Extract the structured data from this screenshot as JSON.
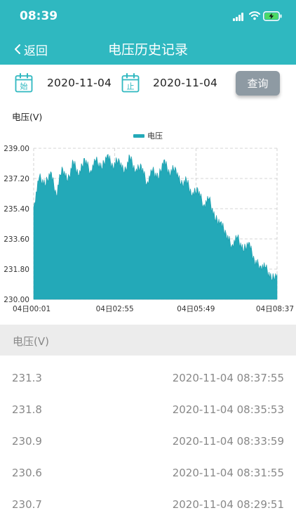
{
  "status_bar": {
    "time": "08:39"
  },
  "nav": {
    "back_label": "返回",
    "title": "电压历史记录"
  },
  "filters": {
    "start_icon_char": "始",
    "start_date": "2020-11-04",
    "end_icon_char": "止",
    "end_date": "2020-11-04",
    "query_label": "查询"
  },
  "chart_data": {
    "type": "area",
    "ylabel": "电压(V)",
    "legend": [
      "电压"
    ],
    "legend_position": "top-center",
    "series_color": "#23a9b8",
    "ylim": [
      230.0,
      239.0
    ],
    "y_ticks": [
      "230.00",
      "231.80",
      "233.60",
      "235.40",
      "237.20",
      "239.00"
    ],
    "x_ticks": [
      "04日00:01",
      "04日02:55",
      "04日05:49",
      "04日08:37"
    ],
    "grid": "dashed",
    "x": [
      "00:01",
      "00:12",
      "00:24",
      "00:36",
      "00:48",
      "01:00",
      "01:12",
      "01:24",
      "01:36",
      "01:48",
      "02:00",
      "02:12",
      "02:24",
      "02:36",
      "02:48",
      "03:00",
      "03:12",
      "03:24",
      "03:36",
      "03:48",
      "04:00",
      "04:12",
      "04:24",
      "04:36",
      "04:48",
      "05:00",
      "05:12",
      "05:24",
      "05:36",
      "05:48",
      "06:00",
      "06:12",
      "06:24",
      "06:36",
      "06:48",
      "07:00",
      "07:12",
      "07:24",
      "07:36",
      "07:48",
      "08:00",
      "08:12",
      "08:24",
      "08:37"
    ],
    "values": [
      235.5,
      237.3,
      236.8,
      237.6,
      236.2,
      237.9,
      237.0,
      238.2,
      237.4,
      238.4,
      237.6,
      238.3,
      237.8,
      238.6,
      237.9,
      238.4,
      237.5,
      238.5,
      237.6,
      238.0,
      236.9,
      237.7,
      237.2,
      238.3,
      237.5,
      237.9,
      236.8,
      237.1,
      236.2,
      236.6,
      235.6,
      236.0,
      234.8,
      234.6,
      233.9,
      233.2,
      233.7,
      232.9,
      233.4,
      232.3,
      232.0,
      231.9,
      231.2,
      231.5
    ]
  },
  "list": {
    "header": "电压(V)",
    "rows": [
      {
        "value": "231.3",
        "time": "2020-11-04 08:37:55"
      },
      {
        "value": "231.8",
        "time": "2020-11-04 08:35:53"
      },
      {
        "value": "230.9",
        "time": "2020-11-04 08:33:59"
      },
      {
        "value": "230.6",
        "time": "2020-11-04 08:31:55"
      },
      {
        "value": "230.7",
        "time": "2020-11-04 08:29:51"
      }
    ]
  }
}
